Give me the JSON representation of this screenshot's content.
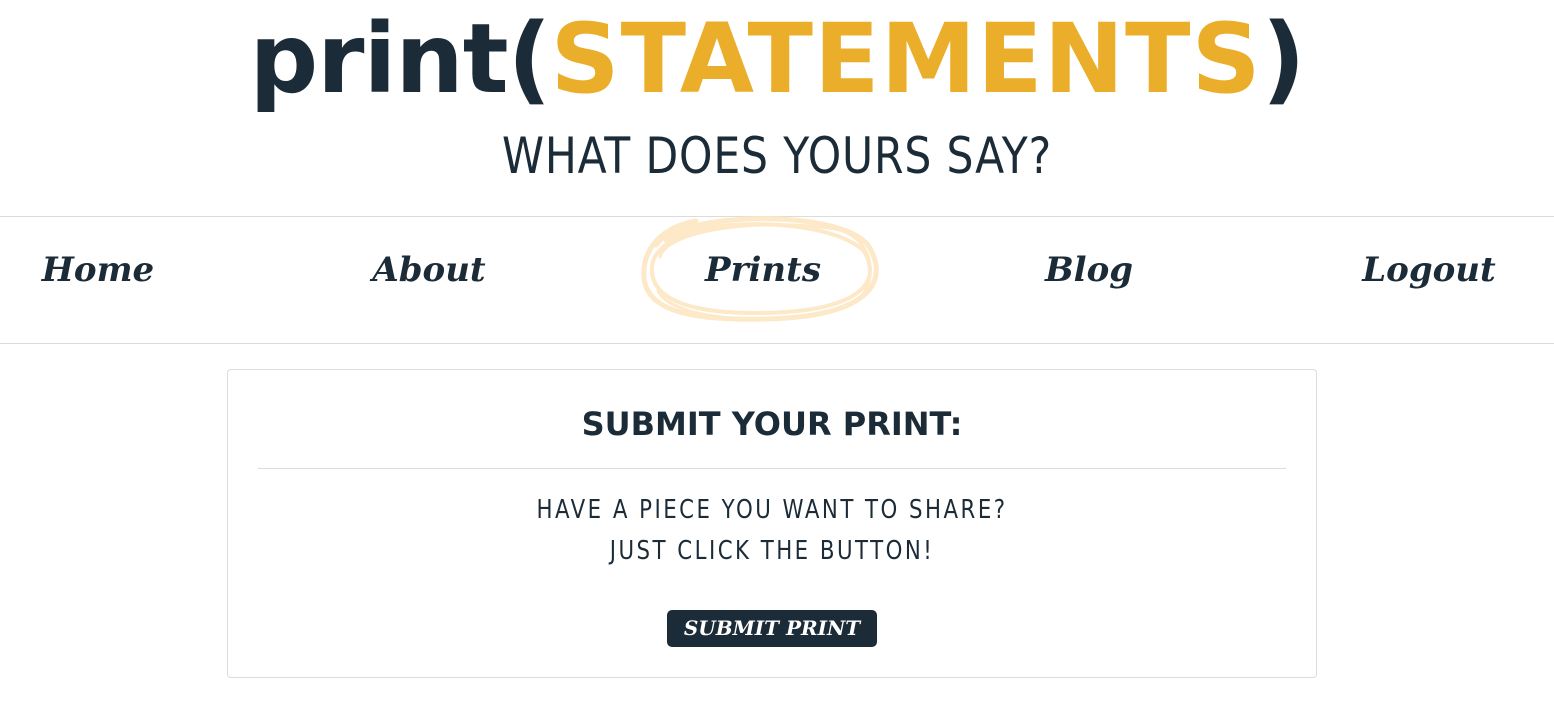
{
  "header": {
    "logo_prefix": "print(",
    "logo_highlight": "STATEMENTS",
    "logo_suffix": ")",
    "tagline": "WHAT DOES YOURS SAY?"
  },
  "nav": {
    "items": [
      {
        "label": "Home"
      },
      {
        "label": "About"
      },
      {
        "label": "Prints",
        "active": true
      },
      {
        "label": "Blog"
      },
      {
        "label": "Logout"
      }
    ]
  },
  "submit_card": {
    "title": "SUBMIT YOUR PRINT:",
    "line1": "HAVE A PIECE YOU WANT TO SHARE?",
    "line2": "JUST CLICK THE BUTTON!",
    "button_label": "SUBMIT PRINT"
  },
  "colors": {
    "primary": "#1b2b37",
    "accent": "#ebae2b",
    "active_highlight": "#fde8c8",
    "border": "#dcdcdc"
  }
}
